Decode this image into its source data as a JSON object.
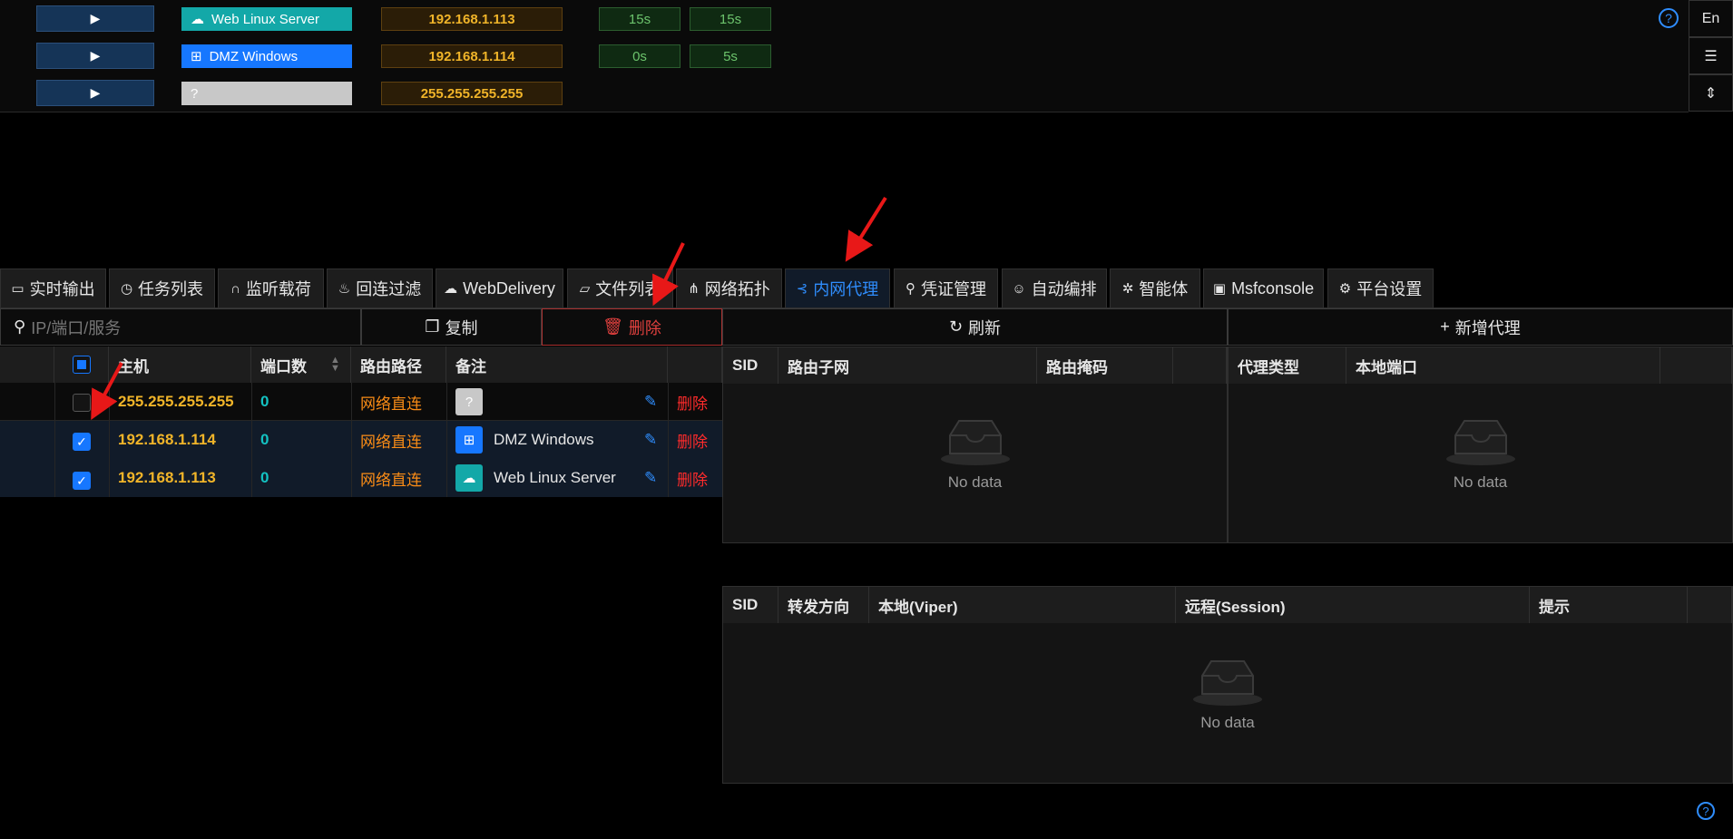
{
  "colors": {
    "accent": "#2f8dfd",
    "ip": "#f0b429",
    "teal": "#13c2c2",
    "orange": "#fa8c16",
    "red": "#ff2b2b",
    "green": "#6cc36c"
  },
  "hosts": [
    {
      "name": "Web Linux Server",
      "icon": "cloud-icon",
      "ip": "192.168.1.113",
      "t1": "15s",
      "t2": "15s"
    },
    {
      "name": "DMZ Windows",
      "icon": "windows-icon",
      "ip": "192.168.1.114",
      "t1": "0s",
      "t2": "5s"
    },
    {
      "name": "?",
      "icon": "unknown-icon",
      "ip": "255.255.255.255",
      "t1": "",
      "t2": ""
    }
  ],
  "side": {
    "lang": "En"
  },
  "tabs": [
    {
      "label": "实时输出",
      "icon": "monitor-icon"
    },
    {
      "label": "任务列表",
      "icon": "clock-icon"
    },
    {
      "label": "监听载荷",
      "icon": "headphones-icon"
    },
    {
      "label": "回连过滤",
      "icon": "fire-icon"
    },
    {
      "label": "WebDelivery",
      "icon": "cloud-upload-icon"
    },
    {
      "label": "文件列表",
      "icon": "folder-icon"
    },
    {
      "label": "网络拓扑",
      "icon": "topology-icon"
    },
    {
      "label": "内网代理",
      "icon": "proxy-icon"
    },
    {
      "label": "凭证管理",
      "icon": "key-icon"
    },
    {
      "label": "自动编排",
      "icon": "robot-icon"
    },
    {
      "label": "智能体",
      "icon": "ai-icon"
    },
    {
      "label": "Msfconsole",
      "icon": "terminal-icon"
    },
    {
      "label": "平台设置",
      "icon": "settings-icon"
    }
  ],
  "toolbar": {
    "search_placeholder": "IP/端口/服务",
    "copy_label": "复制",
    "delete_label": "删除",
    "refresh_label": "刷新",
    "add_proxy_label": "新增代理"
  },
  "route_table": {
    "headers": {
      "host": "主机",
      "ports": "端口数",
      "route": "路由路径",
      "note": "备注"
    },
    "rows": [
      {
        "checked": false,
        "host": "255.255.255.255",
        "ports": "0",
        "route": "网络直连",
        "note": "",
        "note_icon": "unknown-icon",
        "action": "删除"
      },
      {
        "checked": true,
        "host": "192.168.1.114",
        "ports": "0",
        "route": "网络直连",
        "note": "DMZ Windows",
        "note_icon": "windows-icon",
        "action": "删除"
      },
      {
        "checked": true,
        "host": "192.168.1.113",
        "ports": "0",
        "route": "网络直连",
        "note": "Web Linux Server",
        "note_icon": "cloud-icon",
        "action": "删除"
      }
    ]
  },
  "subnet_table": {
    "headers": [
      "SID",
      "路由子网",
      "路由掩码"
    ],
    "empty": "No data"
  },
  "proxy_table": {
    "headers": [
      "代理类型",
      "本地端口"
    ],
    "empty": "No data"
  },
  "forward_table": {
    "headers": [
      "SID",
      "转发方向",
      "本地(Viper)",
      "远程(Session)",
      "提示"
    ],
    "empty": "No data"
  }
}
